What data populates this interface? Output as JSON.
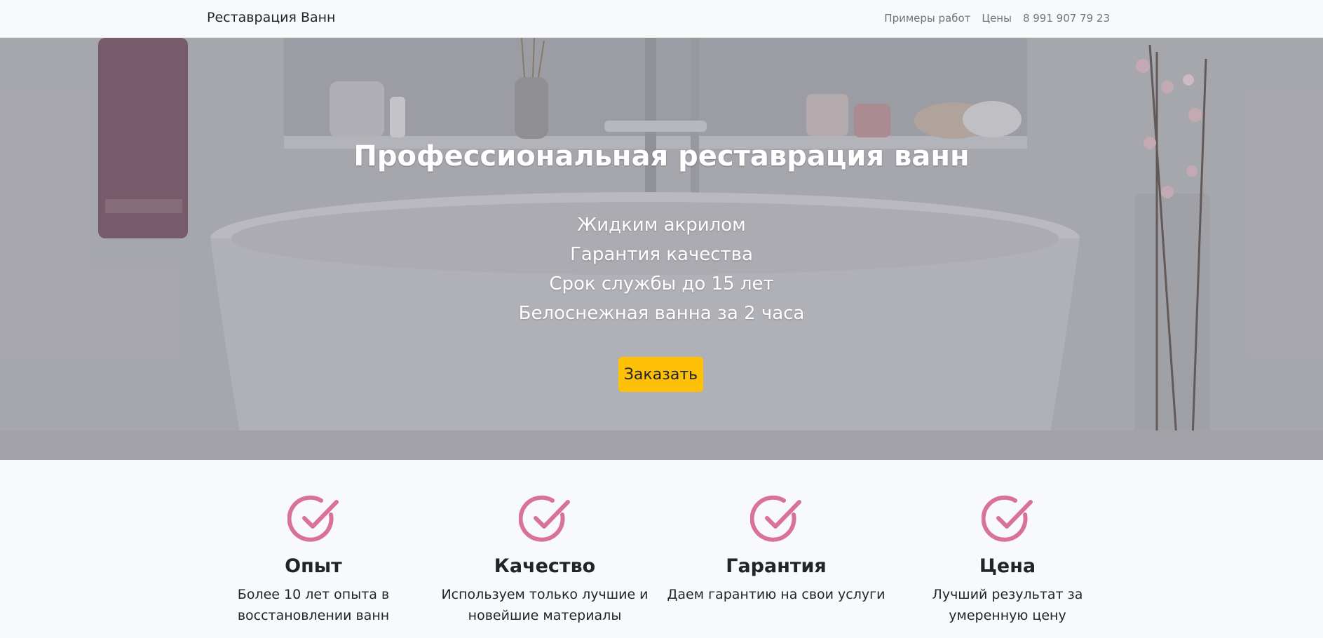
{
  "navbar": {
    "brand": "Реставрация Ванн",
    "links": [
      "Примеры работ",
      "Цены"
    ],
    "phone": "8 991 907 79 23"
  },
  "hero": {
    "title": "Профессиональная реставрация ванн",
    "lines": [
      "Жидким акрилом",
      "Гарантия качества",
      "Срок службы до 15 лет",
      "Белоснежная ванна за 2 часа"
    ],
    "button_label": "Заказать",
    "button_color": "#ffc107"
  },
  "features": [
    {
      "icon": "check-circle-icon",
      "title": "Опыт",
      "text": "Более 10 лет опыта в восстановлении ванн"
    },
    {
      "icon": "check-circle-icon",
      "title": "Качество",
      "text": "Используем только лучшие и новейшие материалы"
    },
    {
      "icon": "check-circle-icon",
      "title": "Гарантия",
      "text": "Даем гарантию на свои услуги"
    },
    {
      "icon": "check-circle-icon",
      "title": "Цена",
      "text": "Лучший результат за умеренную цену"
    }
  ],
  "colors": {
    "accent_pink": "#d9729a",
    "button_yellow": "#ffc107",
    "page_bg": "#f8f9fa"
  }
}
